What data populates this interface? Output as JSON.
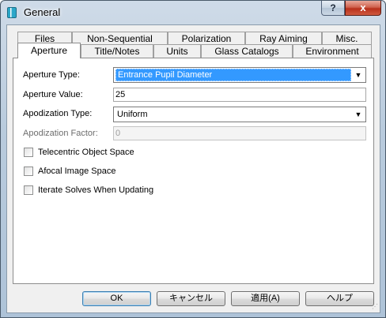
{
  "window": {
    "title": "General",
    "help_glyph": "?",
    "close_glyph": "x"
  },
  "tabs": {
    "back_row": [
      {
        "label": "Files"
      },
      {
        "label": "Non-Sequential"
      },
      {
        "label": "Polarization"
      },
      {
        "label": "Ray Aiming"
      },
      {
        "label": "Misc."
      }
    ],
    "front_row": [
      {
        "label": "Aperture",
        "active": true
      },
      {
        "label": "Title/Notes"
      },
      {
        "label": "Units"
      },
      {
        "label": "Glass Catalogs"
      },
      {
        "label": "Environment"
      }
    ]
  },
  "aperture": {
    "aperture_type_label": "Aperture Type:",
    "aperture_type_value": "Entrance Pupil Diameter",
    "aperture_value_label": "Aperture Value:",
    "aperture_value": "25",
    "apodization_type_label": "Apodization Type:",
    "apodization_type_value": "Uniform",
    "apodization_factor_label": "Apodization Factor:",
    "apodization_factor_value": "0",
    "checkboxes": [
      {
        "label": "Telecentric Object Space",
        "checked": false
      },
      {
        "label": "Afocal Image Space",
        "checked": false
      },
      {
        "label": "Iterate Solves When Updating",
        "checked": false
      }
    ]
  },
  "buttons": {
    "ok": "OK",
    "cancel": "キャンセル",
    "apply": "適用(A)",
    "help": "ヘルプ"
  },
  "colors": {
    "selection": "#3399ff",
    "close_button": "#c7432c",
    "dialog_face": "#f0f0f0"
  }
}
